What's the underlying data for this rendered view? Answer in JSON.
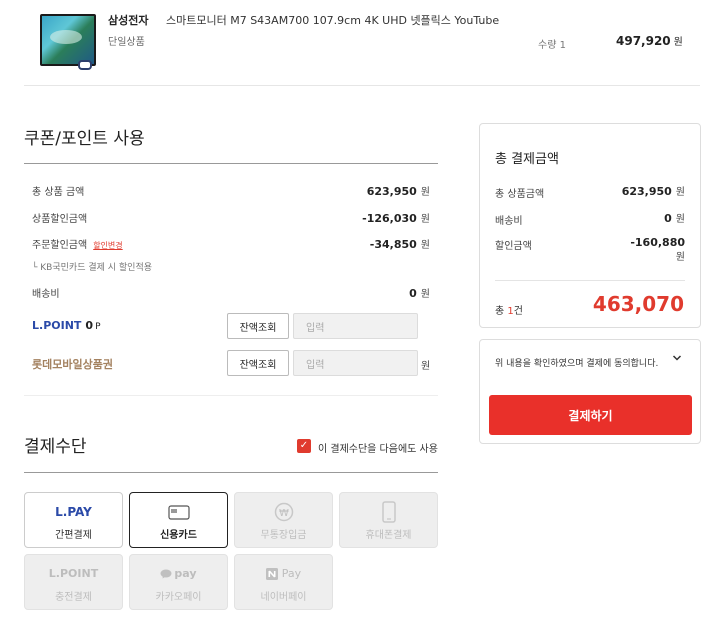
{
  "product": {
    "brand": "삼성전자",
    "name": "스마트모니터 M7 S43AM700 107.9cm 4K UHD 넷플릭스 YouTube",
    "option": "단일상품",
    "qty": "수량 1",
    "price": "497,920",
    "price_unit": "원"
  },
  "coupon": {
    "title": "쿠폰/포인트 사용",
    "rows": [
      {
        "label": "총 상품 금액",
        "value": "623,950",
        "unit": "원"
      },
      {
        "label": "상품할인금액",
        "value": "-126,030",
        "unit": "원"
      },
      {
        "label": "주문할인금액",
        "link": "할인변경",
        "value": "-34,850",
        "unit": "원"
      },
      {
        "label": "배송비",
        "value": "0",
        "unit": "원"
      }
    ],
    "note": "└ KB국민카드 결제 시 할인적용",
    "lpoint_label": "L.POINT",
    "lpoint_value": "0",
    "lpoint_unit": "P",
    "gift_label": "롯데모바일상품권",
    "balance_button": "잔액조회",
    "input_placeholder": "입력",
    "won": "원"
  },
  "payment": {
    "title": "결제수단",
    "reuse_label": "이 결제수단을 다음에도 사용",
    "methods": [
      {
        "top": "L.PAY",
        "bottom": "간편결제",
        "state": "normal"
      },
      {
        "icon": "card-icon",
        "bottom": "신용카드",
        "state": "selected"
      },
      {
        "icon": "won-coin-icon",
        "bottom": "무통장입금",
        "state": "disabled"
      },
      {
        "icon": "phone-icon",
        "bottom": "휴대폰결제",
        "state": "disabled"
      },
      {
        "top": "L.POINT",
        "bottom": "충전결제",
        "state": "disabled"
      },
      {
        "top": "pay",
        "icon": "kakao-bubble-icon",
        "bottom": "카카오페이",
        "state": "disabled"
      },
      {
        "top": "Pay",
        "icon": "naver-n-icon",
        "bottom": "네이버페이",
        "state": "disabled"
      }
    ]
  },
  "summary": {
    "title": "총 결제금액",
    "rows": [
      {
        "label": "총 상품금액",
        "value": "623,950",
        "unit": "원"
      },
      {
        "label": "배송비",
        "value": "0",
        "unit": "원"
      },
      {
        "label": "할인금액",
        "value": "-160,880",
        "unit": "원"
      }
    ],
    "count_prefix": "총 ",
    "count": "1",
    "count_suffix": "건",
    "total": "463,070"
  },
  "agree": {
    "text": "위 내용을 확인하였으며 결제에 동의합니다.",
    "button": "결제하기"
  },
  "colors": {
    "accent": "#e9302a",
    "lpoint_blue": "#2b4aa8",
    "gift_brown": "#a48260"
  }
}
